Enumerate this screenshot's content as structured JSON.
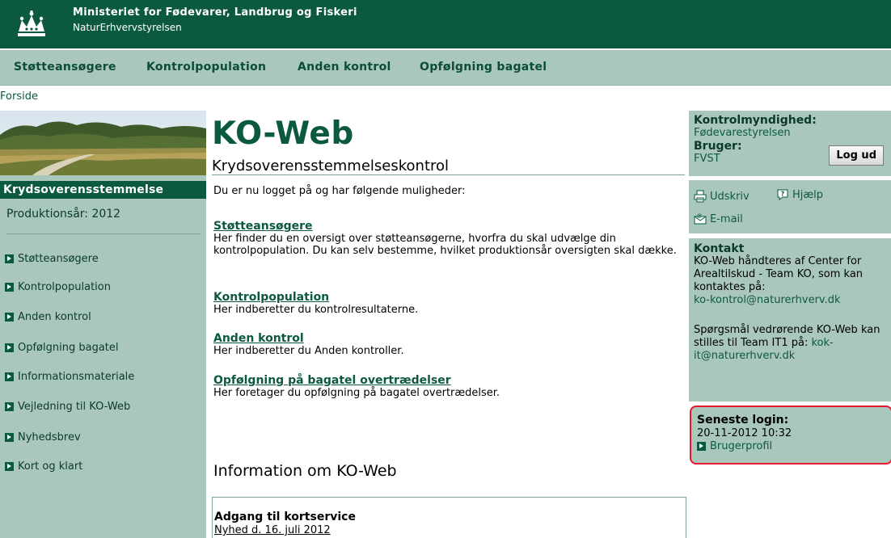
{
  "header": {
    "org_name": "Ministeriet for Fødevarer, Landbrug og Fiskeri",
    "org_sub": "NaturErhvervstyrelsen",
    "logo_icon": "crown-icon"
  },
  "topnav": {
    "items": [
      {
        "label": "Støtteansøgere"
      },
      {
        "label": "Kontrolpopulation"
      },
      {
        "label": "Anden kontrol"
      },
      {
        "label": "Opfølgning bagatel"
      }
    ]
  },
  "breadcrumb": {
    "home": "Forside"
  },
  "sidebar": {
    "heading": "Krydsoverensstemmelse",
    "production_year": "Produktionsår: 2012",
    "items": [
      {
        "label": "Støtteansøgere"
      },
      {
        "label": "Kontrolpopulation"
      },
      {
        "label": "Anden kontrol"
      },
      {
        "label": "Opfølgning bagatel"
      },
      {
        "label": "Informationsmateriale"
      },
      {
        "label": "Vejledning til KO-Web"
      },
      {
        "label": "Nyhedsbrev"
      },
      {
        "label": "Kort og klart"
      }
    ]
  },
  "main": {
    "title": "KO-Web",
    "subtitle": "Krydsoverensstemmelseskontrol",
    "intro": "Du er nu logget på og har følgende muligheder:",
    "sections": [
      {
        "title": "Støtteansøgere",
        "text": "Her finder du en oversigt over støtteansøgerne, hvorfra du skal udvælge din kontrolpopulation. Du kan selv bestemme, hvilket produktionsår oversigten skal dække."
      },
      {
        "title": "Kontrolpopulation",
        "text": "Her indberetter du kontrolresultaterne."
      },
      {
        "title": "Anden kontrol",
        "text": "Her indberetter du Anden kontroller."
      },
      {
        "title": "Opfølgning på bagatel overtrædelser",
        "text": "Her foretager du opfølgning på bagatel overtrædelser."
      }
    ],
    "info_heading": "Information om KO-Web",
    "news": {
      "title": "Adgang til kortservice",
      "date": "Nyhed d. 16. juli 2012"
    }
  },
  "right": {
    "authority_label": "Kontrolmyndighed:",
    "authority_value": "Fødevarestyrelsen",
    "user_label": "Bruger:",
    "user_value": "FVST",
    "logout_label": "Log ud",
    "print_label": "Udskriv",
    "help_label": "Hjælp",
    "email_label": "E-mail",
    "contact_label": "Kontakt",
    "contact_text": "KO-Web håndteres af Center for Arealtilskud - Team KO, som kan kontaktes på:",
    "contact_email": "ko-kontrol@naturerhverv.dk",
    "question_text": "Spørgsmål vedrørende KO-Web kan stilles til Team IT1 på:",
    "question_email": "kok-it@naturerhverv.dk",
    "login_label": "Seneste login:",
    "login_time": "20-11-2012 10:32",
    "profile_label": "Brugerprofil"
  },
  "colors": {
    "brand_green": "#0b5a40",
    "panel_green": "#a9c7bb",
    "highlight_red": "#e8192c"
  }
}
